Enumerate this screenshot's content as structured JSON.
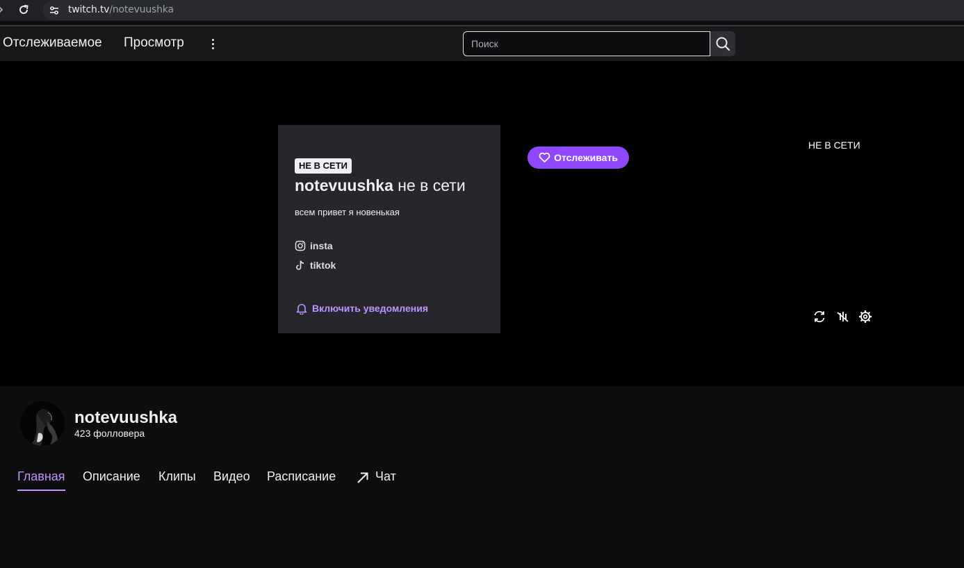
{
  "browser": {
    "url_host": "twitch.tv",
    "url_path": "/notevuushka"
  },
  "topnav": {
    "following_label": "Отслеживаемое",
    "browse_label": "Просмотр",
    "search_placeholder": "Поиск"
  },
  "player": {
    "offline_badge": "НЕ В СЕТИ",
    "channel_name": "notevuushka",
    "offline_suffix": " не в сети",
    "description": "всем привет я новенькая",
    "socials": [
      {
        "label": "insta",
        "icon": "instagram-icon"
      },
      {
        "label": "tiktok",
        "icon": "tiktok-icon"
      }
    ],
    "notify_label": "Включить уведомления",
    "follow_label": "Отслеживать",
    "corner_status": "НЕ В СЕТИ"
  },
  "channel": {
    "name": "notevuushka",
    "followers": "423 фолловера",
    "tabs": [
      {
        "label": "Главная",
        "active": true
      },
      {
        "label": "Описание"
      },
      {
        "label": "Клипы"
      },
      {
        "label": "Видео"
      },
      {
        "label": "Расписание"
      },
      {
        "label": "Чат",
        "icon": "external-arrow-icon"
      }
    ]
  },
  "colors": {
    "accent": "#9147ff",
    "accent_text": "#bf94ff",
    "nav_bg": "#18181b",
    "page_bg": "#0e0e10",
    "card_bg": "#26262c"
  }
}
